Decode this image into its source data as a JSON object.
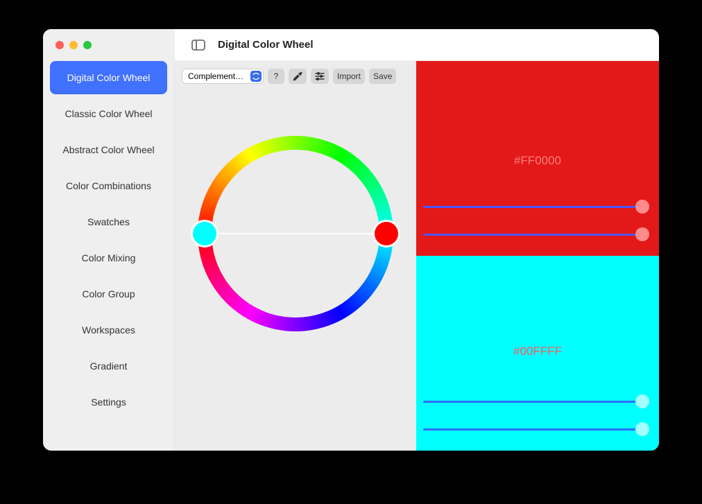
{
  "window_title": "Digital Color Wheel",
  "sidebar": {
    "items": [
      {
        "label": "Digital Color Wheel",
        "active": true
      },
      {
        "label": "Classic Color Wheel",
        "active": false
      },
      {
        "label": "Abstract Color Wheel",
        "active": false
      },
      {
        "label": "Color Combinations",
        "active": false
      },
      {
        "label": "Swatches",
        "active": false
      },
      {
        "label": "Color Mixing",
        "active": false
      },
      {
        "label": "Color Group",
        "active": false
      },
      {
        "label": "Workspaces",
        "active": false
      },
      {
        "label": "Gradient",
        "active": false
      },
      {
        "label": "Settings",
        "active": false
      }
    ]
  },
  "toolbar": {
    "scheme_select": "Complement…",
    "help_label": "?",
    "import_label": "Import",
    "save_label": "Save"
  },
  "wheel": {
    "node_left_color": "#00FFFF",
    "node_right_color": "#FF0000"
  },
  "panels": [
    {
      "bg": "#E31919",
      "hex": "#FF0000",
      "sliders": [
        {
          "value": 100
        },
        {
          "value": 100
        }
      ]
    },
    {
      "bg": "#00FFFF",
      "hex": "#00FFFF",
      "sliders": [
        {
          "value": 100
        },
        {
          "value": 100
        }
      ]
    }
  ]
}
